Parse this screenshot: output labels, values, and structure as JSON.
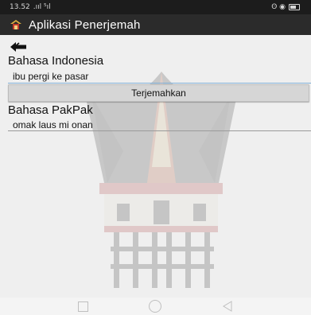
{
  "status_bar": {
    "time": "13.52",
    "signal_text": ".ııl ⁵ıl",
    "right_text": "ʘ ◉"
  },
  "app": {
    "title": "Aplikasi Penerjemah",
    "icon": "rumah-adat-icon"
  },
  "translator": {
    "source_label": "Bahasa Indonesia",
    "source_value": "ibu pergi ke pasar",
    "button_label": "Terjemahkan",
    "target_label": "Bahasa PakPak",
    "target_value": "omak laus mi onan"
  },
  "nav": {
    "icons": [
      "recent-apps-icon",
      "home-icon",
      "back-nav-icon"
    ]
  }
}
